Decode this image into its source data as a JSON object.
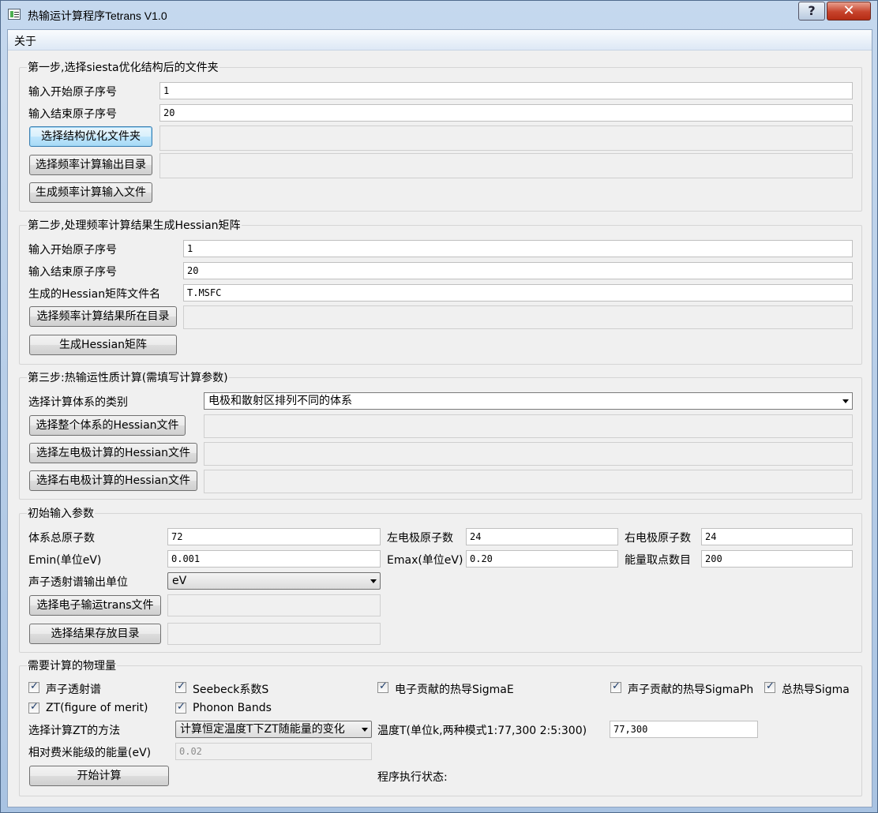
{
  "window": {
    "title": "热输运计算程序Tetrans V1.0",
    "help_glyph": "?",
    "close_glyph": "✕"
  },
  "menu": {
    "about": "关于"
  },
  "step1": {
    "title": "第一步,选择siesta优化结构后的文件夹",
    "start_atom_label": "输入开始原子序号",
    "start_atom_value": "1",
    "end_atom_label": "输入结束原子序号",
    "end_atom_value": "20",
    "select_opt_folder_button": "选择结构优化文件夹",
    "select_freq_out_button": "选择频率计算输出目录",
    "gen_freq_input_button": "生成频率计算输入文件"
  },
  "step2": {
    "title": "第二步,处理频率计算结果生成Hessian矩阵",
    "start_atom_label": "输入开始原子序号",
    "start_atom_value": "1",
    "end_atom_label": "输入结束原子序号",
    "end_atom_value": "20",
    "hessian_file_label": "生成的Hessian矩阵文件名",
    "hessian_file_value": "T.MSFC",
    "select_freq_result_button": "选择频率计算结果所在目录",
    "gen_hessian_button": "生成Hessian矩阵"
  },
  "step3": {
    "title": "第三步:热输运性质计算(需填写计算参数)",
    "system_type_label": "选择计算体系的类别",
    "system_type_value": "电极和散射区排列不同的体系",
    "select_whole_hessian_button": "选择整个体系的Hessian文件",
    "select_left_hessian_button": "选择左电极计算的Hessian文件",
    "select_right_hessian_button": "选择右电极计算的Hessian文件"
  },
  "params": {
    "title": "初始输入参数",
    "total_atoms_label": "体系总原子数",
    "total_atoms_value": "72",
    "left_atoms_label": "左电极原子数",
    "left_atoms_value": "24",
    "right_atoms_label": "右电极原子数",
    "right_atoms_value": "24",
    "emin_label": "Emin(单位eV)",
    "emin_value": "0.001",
    "emax_label": "Emax(单位eV)",
    "emax_value": "0.20",
    "energy_points_label": "能量取点数目",
    "energy_points_value": "200",
    "phonon_unit_label": "声子透射谱输出单位",
    "phonon_unit_value": "eV",
    "select_trans_button": "选择电子输运trans文件",
    "select_result_dir_button": "选择结果存放目录"
  },
  "physics": {
    "title": "需要计算的物理量",
    "checks": [
      {
        "label": "声子透射谱",
        "checked": true
      },
      {
        "label": "Seebeck系数S",
        "checked": true
      },
      {
        "label": "电子贡献的热导SigmaE",
        "checked": true
      },
      {
        "label": "声子贡献的热导SigmaPh",
        "checked": true
      },
      {
        "label": "总热导Sigma",
        "checked": true
      },
      {
        "label": "ZT(figure of merit)",
        "checked": true
      },
      {
        "label": "Phonon Bands",
        "checked": true
      }
    ],
    "zt_method_label": "选择计算ZT的方法",
    "zt_method_value": "计算恒定温度T下ZT随能量的变化",
    "temperature_label": "温度T(单位k,两种模式1:77,300 2:5:300)",
    "temperature_value": "77,300",
    "fermi_label": "相对费米能级的能量(eV)",
    "fermi_value": "0.02",
    "start_button": "开始计算",
    "status_label": "程序执行状态:"
  }
}
